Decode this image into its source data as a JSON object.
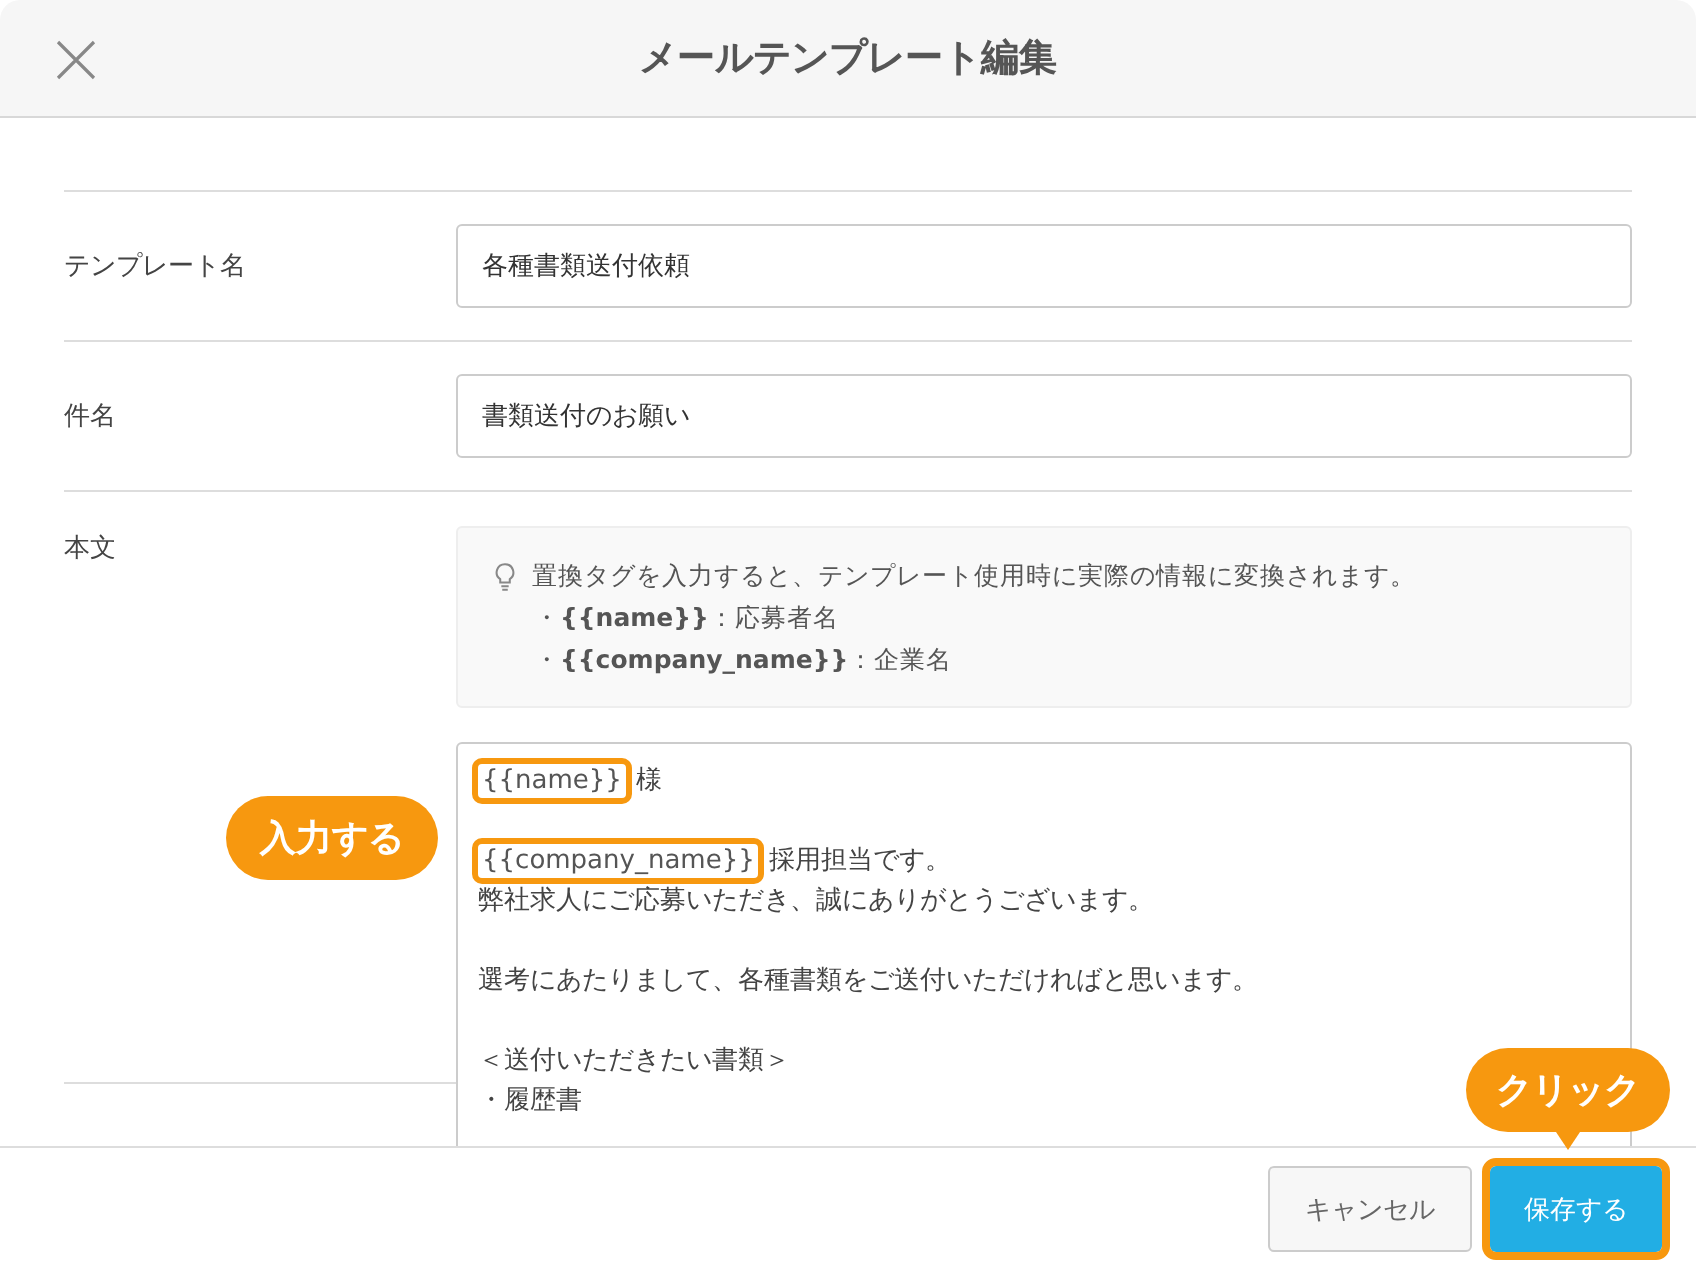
{
  "dialog": {
    "title": "メールテンプレート編集"
  },
  "fields": [
    {
      "label": "テンプレート名",
      "value": "各種書類送付依頼"
    },
    {
      "label": "件名",
      "value": "書類送付のお願い"
    }
  ],
  "body": {
    "label": "本文",
    "hint": {
      "text": "置換タグを入力すると、テンプレート使用時に実際の情報に変換されます。",
      "items": [
        "・**{{name}}**：応募者名",
        "・**{{company_name}}**：企業名"
      ]
    },
    "lines": [
      {
        "kind": "tagged",
        "tag": "{{name}}",
        "rest": "様",
        "highlighted": true
      },
      {
        "kind": "blank"
      },
      {
        "kind": "tagged",
        "tag": "{{company_name}}",
        "rest": "採用担当です。",
        "highlighted": true
      },
      {
        "kind": "text",
        "text": "弊社求人にご応募いただき、誠にありがとうございます。"
      },
      {
        "kind": "blank"
      },
      {
        "kind": "text",
        "text": "選考にあたりまして、各種書類をご送付いただければと思います。"
      },
      {
        "kind": "blank"
      },
      {
        "kind": "text",
        "text": "＜送付いただきたい書類＞"
      },
      {
        "kind": "text",
        "text": "・履歴書"
      }
    ]
  },
  "annotations": [
    {
      "kind": "input",
      "text": "入力する"
    },
    {
      "kind": "click",
      "text": "クリック"
    }
  ],
  "buttons": [
    {
      "kind": "cancel",
      "label": "キャンセル",
      "highlighted": false
    },
    {
      "kind": "save",
      "label": "保存する",
      "highlighted": true
    }
  ]
}
